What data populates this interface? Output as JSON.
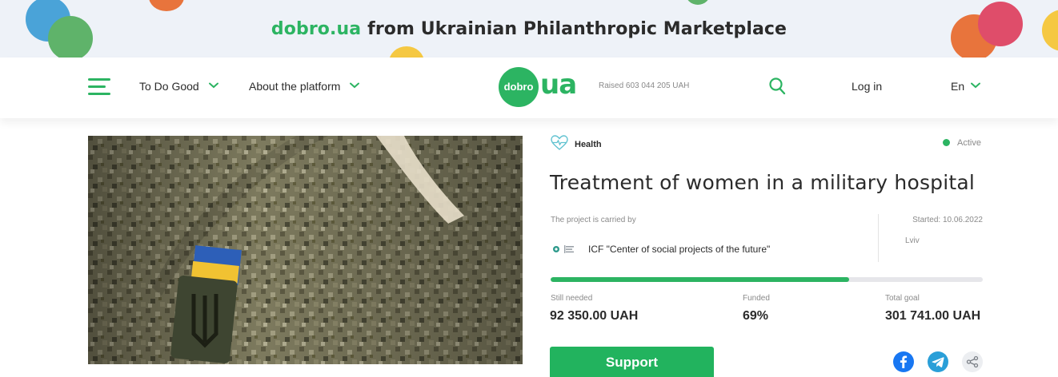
{
  "banner": {
    "brand": "dobro.ua",
    "text": "from Ukrainian Philanthropic Marketplace"
  },
  "header": {
    "nav": [
      {
        "label": "To Do Good",
        "icon": "chevron-down-icon"
      },
      {
        "label": "About the platform",
        "icon": "chevron-down-icon"
      }
    ],
    "logo_badge": "dobro",
    "logo_ua": "ua",
    "raised": "Raised 603 044 205 UAH",
    "login": "Log in",
    "language": "En"
  },
  "project": {
    "category": "Health",
    "status": "Active",
    "title": "Treatment of women in a military hospital",
    "carried_by_label": "The project is carried by",
    "organization": "ICF \"Center of social projects of the future\"",
    "started": "Started: 10.06.2022",
    "city": "Lviv",
    "progress_fraction": 0.69,
    "still_needed_label": "Still needed",
    "still_needed_value": "92 350.00 UAH",
    "funded_label": "Funded",
    "funded_value": "69%",
    "total_goal_label": "Total goal",
    "total_goal_value": "301 741.00 UAH",
    "support_label": "Support"
  },
  "colors": {
    "accent": "#2cb462",
    "facebook": "#1877f2",
    "telegram": "#2a9fd8"
  }
}
